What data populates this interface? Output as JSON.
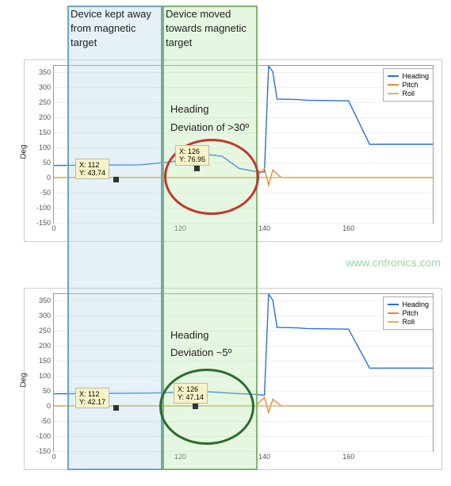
{
  "overlays": {
    "blue": {
      "text": "Device kept away from magnetic target"
    },
    "green": {
      "text": "Device moved towards magnetic target"
    }
  },
  "axis": {
    "ylabel": "Deg",
    "yticks": [
      "-150",
      "-100",
      "-50",
      "0",
      "50",
      "100",
      "150",
      "200",
      "250",
      "300",
      "350"
    ],
    "xticks": [
      "0",
      "120",
      "140",
      "160"
    ]
  },
  "legend": {
    "items": [
      {
        "label": "Heading",
        "color": "#2a6fdb"
      },
      {
        "label": "Pitch",
        "color": "#e08b3a"
      },
      {
        "label": "Roll",
        "color": "#d9b84a"
      }
    ]
  },
  "top_chart": {
    "datatip1": {
      "x_label": "X: 112",
      "y_label": "Y: 43.74"
    },
    "datatip2": {
      "x_label": "X: 126",
      "y_label": "Y: 76.95"
    },
    "annot1": "Heading",
    "annot2": "Deviation of >30º"
  },
  "bottom_chart": {
    "datatip1": {
      "x_label": "X: 112",
      "y_label": "Y: 42.17"
    },
    "datatip2": {
      "x_label": "X: 126",
      "y_label": "Y: 47.14"
    },
    "annot1": "Heading",
    "annot2": "Deviation ~5º"
  },
  "watermark": "www.cntronics.com",
  "chart_data": [
    {
      "type": "line",
      "title": "Top chart (without correction)",
      "xlabel": "",
      "ylabel": "Deg",
      "xlim": [
        90,
        180
      ],
      "ylim": [
        -150,
        370
      ],
      "annotations": [
        "Heading Deviation of >30º"
      ],
      "datatips": [
        {
          "x": 112,
          "y": 43.74
        },
        {
          "x": 126,
          "y": 76.95
        }
      ],
      "series": [
        {
          "name": "Heading",
          "color": "#2a6fdb",
          "x": [
            90,
            110,
            112,
            118,
            124,
            126,
            130,
            134,
            138,
            140,
            141,
            142,
            143,
            148,
            150,
            160,
            165,
            180
          ],
          "y": [
            40,
            42,
            43.74,
            52,
            70,
            76.95,
            70,
            30,
            20,
            18,
            370,
            350,
            260,
            258,
            256,
            254,
            110,
            110
          ]
        },
        {
          "name": "Pitch",
          "color": "#e08b3a",
          "x": [
            90,
            138,
            140,
            141,
            142,
            144,
            180
          ],
          "y": [
            0,
            0,
            30,
            -25,
            25,
            0,
            0
          ]
        },
        {
          "name": "Roll",
          "color": "#d9b84a",
          "x": [
            90,
            180
          ],
          "y": [
            0,
            0
          ]
        }
      ]
    },
    {
      "type": "line",
      "title": "Bottom chart (with correction)",
      "xlabel": "",
      "ylabel": "Deg",
      "xlim": [
        90,
        180
      ],
      "ylim": [
        -150,
        370
      ],
      "annotations": [
        "Heading Deviation ~5º"
      ],
      "datatips": [
        {
          "x": 112,
          "y": 42.17
        },
        {
          "x": 126,
          "y": 47.14
        }
      ],
      "series": [
        {
          "name": "Heading",
          "color": "#2a6fdb",
          "x": [
            90,
            112,
            120,
            126,
            132,
            138,
            140,
            141,
            142,
            143,
            148,
            150,
            160,
            165,
            180
          ],
          "y": [
            40,
            42.17,
            44,
            47.14,
            42,
            38,
            35,
            370,
            350,
            260,
            258,
            256,
            254,
            125,
            125
          ]
        },
        {
          "name": "Pitch",
          "color": "#e08b3a",
          "x": [
            90,
            138,
            140,
            141,
            142,
            144,
            180
          ],
          "y": [
            0,
            0,
            28,
            -22,
            22,
            0,
            0
          ]
        },
        {
          "name": "Roll",
          "color": "#d9b84a",
          "x": [
            90,
            180
          ],
          "y": [
            0,
            0
          ]
        }
      ]
    }
  ]
}
